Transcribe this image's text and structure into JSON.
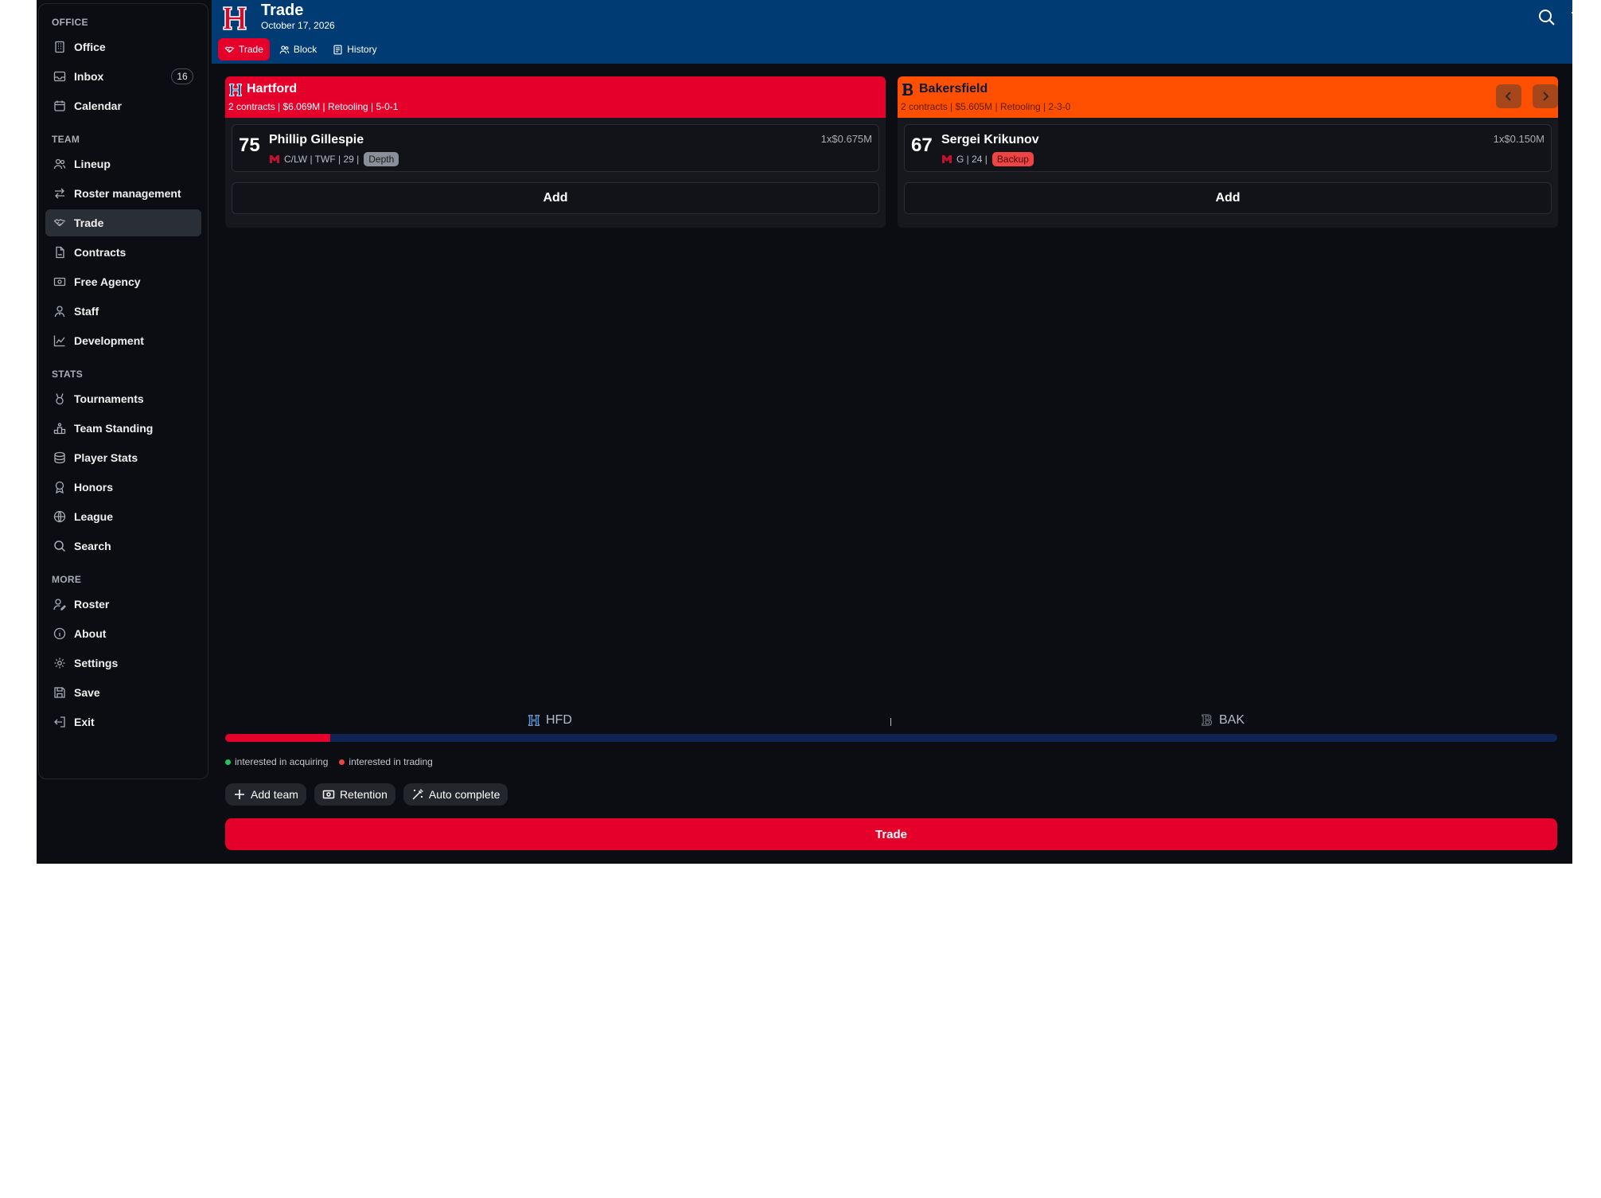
{
  "header": {
    "title": "Trade",
    "date": "October 17, 2026",
    "tabs": [
      {
        "label": "Trade",
        "icon": "handshake-icon",
        "active": true
      },
      {
        "label": "Block",
        "icon": "users-icon"
      },
      {
        "label": "History",
        "icon": "list-icon"
      }
    ],
    "actions": [
      "search-icon",
      "trash-icon"
    ]
  },
  "sidebar": {
    "sections": [
      {
        "title": "OFFICE",
        "items": [
          {
            "label": "Office",
            "icon": "building-icon"
          },
          {
            "label": "Inbox",
            "icon": "inbox-icon",
            "badge": "16"
          },
          {
            "label": "Calendar",
            "icon": "calendar-icon"
          }
        ]
      },
      {
        "title": "TEAM",
        "items": [
          {
            "label": "Lineup",
            "icon": "users-icon"
          },
          {
            "label": "Roster management",
            "icon": "arrows-swap-icon"
          },
          {
            "label": "Trade",
            "icon": "handshake-icon",
            "active": true
          },
          {
            "label": "Contracts",
            "icon": "file-contract-icon"
          },
          {
            "label": "Free Agency",
            "icon": "cash-icon"
          },
          {
            "label": "Staff",
            "icon": "user-tie-icon"
          },
          {
            "label": "Development",
            "icon": "chart-line-icon"
          }
        ]
      },
      {
        "title": "STATS",
        "items": [
          {
            "label": "Tournaments",
            "icon": "medal-icon"
          },
          {
            "label": "Team Standing",
            "icon": "podium-icon"
          },
          {
            "label": "Player Stats",
            "icon": "database-icon"
          },
          {
            "label": "Honors",
            "icon": "award-icon"
          },
          {
            "label": "League",
            "icon": "globe-icon"
          },
          {
            "label": "Search",
            "icon": "search-icon"
          }
        ]
      },
      {
        "title": "MORE",
        "items": [
          {
            "label": "Roster",
            "icon": "user-edit-icon"
          },
          {
            "label": "About",
            "icon": "info-icon"
          },
          {
            "label": "Settings",
            "icon": "gear-icon"
          },
          {
            "label": "Save",
            "icon": "save-icon"
          },
          {
            "label": "Exit",
            "icon": "exit-icon"
          }
        ]
      }
    ]
  },
  "teams": [
    {
      "name": "Hartford",
      "abbr": "HFD",
      "letter": "H",
      "color": "#e4002b",
      "summary": "2 contracts | $6.069M | Retooling | 5-0-1",
      "players": [
        {
          "ovr": "75",
          "name": "Phillip Gillespie",
          "meta": "C/LW | TWF | 29 |",
          "role": "Depth",
          "contract": "1x$0.675M"
        }
      ],
      "add_label": "Add"
    },
    {
      "name": "Bakersfield",
      "abbr": "BAK",
      "letter": "B",
      "color": "#ff4f00",
      "summary": "2 contracts | $5.605M | Retooling | 2-3-0",
      "players": [
        {
          "ovr": "67",
          "name": "Sergei Krikunov",
          "meta": "G | 24 |",
          "role": "Backup",
          "contract": "1x$0.150M"
        }
      ],
      "add_label": "Add"
    }
  ],
  "balance": {
    "left_team": "HFD",
    "right_team": "BAK",
    "left_share": 0.079
  },
  "legend": [
    {
      "label": "interested in acquiring",
      "color": "#22c55e"
    },
    {
      "label": "interested in trading",
      "color": "#ef4444"
    }
  ],
  "actions": [
    {
      "label": "Add team",
      "icon": "plus-icon"
    },
    {
      "label": "Retention",
      "icon": "cash-icon"
    },
    {
      "label": "Auto complete",
      "icon": "magic-wand-icon"
    }
  ],
  "submit_label": "Trade"
}
